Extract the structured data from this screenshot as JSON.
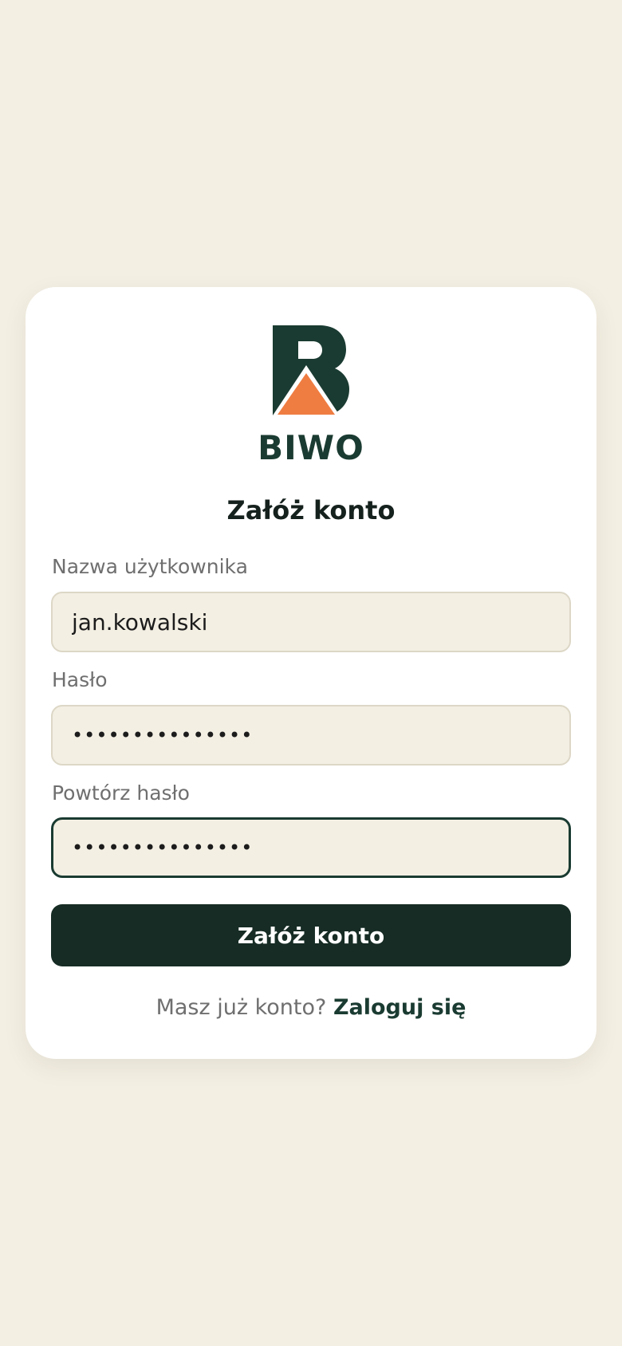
{
  "brand": {
    "name": "BIWO",
    "primary_color": "#1a3b31",
    "accent_color": "#ef7d42",
    "background_color": "#f3efe3"
  },
  "form": {
    "title": "Załóż konto",
    "username": {
      "label": "Nazwa użytkownika",
      "value": "jan.kowalski"
    },
    "password": {
      "label": "Hasło",
      "value": "•••••••••••••••"
    },
    "password_repeat": {
      "label": "Powtórz hasło",
      "value": "•••••••••••••••"
    },
    "submit_label": "Załóż konto"
  },
  "footer": {
    "prompt": "Masz już konto?",
    "login_link": "Zaloguj się"
  }
}
